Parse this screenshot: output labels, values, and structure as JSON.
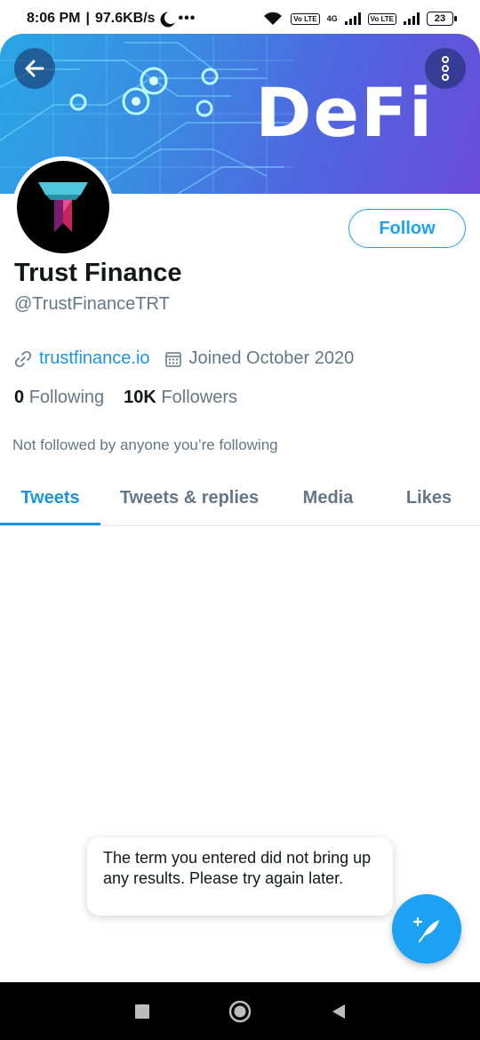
{
  "status_bar": {
    "time": "8:06 PM",
    "speed": "97.6KB/s",
    "extra": "•••",
    "network": "4G",
    "lte1": "Vo LTE",
    "lte2": "Vo LTE",
    "battery": "23"
  },
  "banner": {
    "text": "DeFi"
  },
  "profile": {
    "name": "Trust Finance",
    "handle": "@TrustFinanceTRT",
    "website": "trustfinance.io",
    "joined": "Joined October 2020",
    "following_count": "0",
    "following_label": "Following",
    "followers_count": "10K",
    "followers_label": "Followers",
    "not_followed": "Not followed by anyone you’re following"
  },
  "follow_button": "Follow",
  "tabs": [
    {
      "label": "Tweets",
      "active": true
    },
    {
      "label": "Tweets & replies",
      "active": false
    },
    {
      "label": "Media",
      "active": false
    },
    {
      "label": "Likes",
      "active": false
    }
  ],
  "toast": "The term you entered did not bring up any results. Please try again later.",
  "colors": {
    "accent": "#1da1f2",
    "link": "#1b95e0",
    "muted": "#657786"
  },
  "icons": [
    "back-arrow-icon",
    "more-vertical-icon",
    "link-icon",
    "calendar-icon",
    "compose-tweet-icon",
    "square-nav-icon",
    "circle-nav-icon",
    "triangle-nav-icon"
  ]
}
